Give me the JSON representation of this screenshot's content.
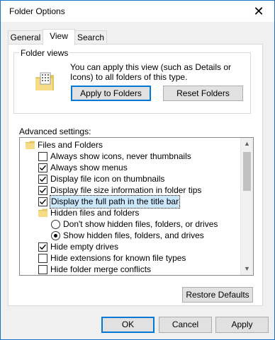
{
  "window": {
    "title": "Folder Options"
  },
  "tabs": [
    {
      "label": "General"
    },
    {
      "label": "View"
    },
    {
      "label": "Search"
    }
  ],
  "folder_views": {
    "label": "Folder views",
    "description": "You can apply this view (such as Details or Icons) to all folders of this type.",
    "apply_button": "Apply to Folders",
    "reset_button": "Reset Folders"
  },
  "advanced": {
    "label": "Advanced settings:",
    "items": [
      {
        "type": "folder",
        "label": "Files and Folders",
        "indent": 0
      },
      {
        "type": "checkbox",
        "label": "Always show icons, never thumbnails",
        "checked": false,
        "indent": 1
      },
      {
        "type": "checkbox",
        "label": "Always show menus",
        "checked": true,
        "indent": 1
      },
      {
        "type": "checkbox",
        "label": "Display file icon on thumbnails",
        "checked": true,
        "indent": 1
      },
      {
        "type": "checkbox",
        "label": "Display file size information in folder tips",
        "checked": true,
        "indent": 1
      },
      {
        "type": "checkbox",
        "label": "Display the full path in the title bar",
        "checked": true,
        "indent": 1,
        "selected": true
      },
      {
        "type": "folder",
        "label": "Hidden files and folders",
        "indent": 1
      },
      {
        "type": "radio",
        "label": "Don't show hidden files, folders, or drives",
        "checked": false,
        "indent": 2
      },
      {
        "type": "radio",
        "label": "Show hidden files, folders, and drives",
        "checked": true,
        "indent": 2
      },
      {
        "type": "checkbox",
        "label": "Hide empty drives",
        "checked": true,
        "indent": 1
      },
      {
        "type": "checkbox",
        "label": "Hide extensions for known file types",
        "checked": false,
        "indent": 1
      },
      {
        "type": "checkbox",
        "label": "Hide folder merge conflicts",
        "checked": false,
        "indent": 1
      }
    ]
  },
  "restore_button": "Restore Defaults",
  "footer": {
    "ok": "OK",
    "cancel": "Cancel",
    "apply": "Apply"
  },
  "icons": {
    "close": "close-icon",
    "folder": "folder-icon",
    "scroll_up": "chevron-up-icon",
    "scroll_down": "chevron-down-icon"
  }
}
